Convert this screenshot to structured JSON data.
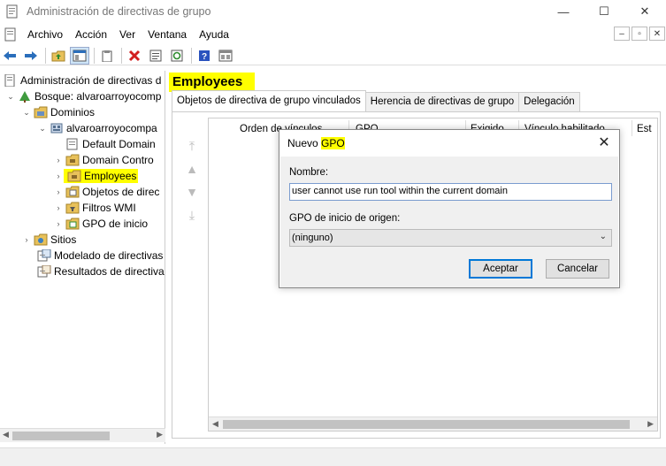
{
  "window": {
    "title": "Administración de directivas de grupo",
    "min_glyph": "—",
    "max_glyph": "☐",
    "close_glyph": "✕"
  },
  "menu": {
    "items": [
      "Archivo",
      "Acción",
      "Ver",
      "Ventana",
      "Ayuda"
    ],
    "mdi": [
      "–",
      "▫",
      "✕"
    ]
  },
  "toolbar": {
    "icons": [
      "back-icon",
      "forward-icon",
      "up-folder-icon",
      "show-hide-tree-icon",
      "clipboard-icon",
      "delete-icon",
      "properties-icon",
      "refresh-icon",
      "help-icon",
      "console-icon"
    ]
  },
  "tree": {
    "root": "Administración de directivas d",
    "forest": "Bosque: alvaroarroyocomp",
    "domains": "Dominios",
    "domain": "alvaroarroyocompa",
    "default_domain": "Default Domain",
    "domain_controllers": "Domain Contro",
    "employees": "Employees",
    "gpo_objects": "Objetos de direc",
    "wmi_filters": "Filtros WMI",
    "starter_gpos": "GPO de inicio",
    "sites": "Sitios",
    "modeling": "Modelado de directivas",
    "results": "Resultados de directiva"
  },
  "right": {
    "header": "Employees",
    "tabs": [
      "Objetos de directiva de grupo vinculados",
      "Herencia de directivas de grupo",
      "Delegación"
    ],
    "columns": [
      "Orden de vínculos",
      "GPO",
      "Exigido",
      "Vínculo habilitado",
      "Est"
    ],
    "order_arrows": [
      "⤒",
      "▲",
      "▼",
      "⤓"
    ]
  },
  "dialog": {
    "title_prefix": "Nuevo ",
    "title_highlight": "GPO",
    "close": "✕",
    "name_label": "Nombre:",
    "name_value": "user cannot use run tool within the current domain",
    "source_label": "GPO de inicio de origen:",
    "source_value": "(ninguno)",
    "ok_label": "Aceptar",
    "cancel_label": "Cancelar"
  },
  "colors": {
    "highlight": "#ffff00",
    "accent": "#0078d7"
  }
}
